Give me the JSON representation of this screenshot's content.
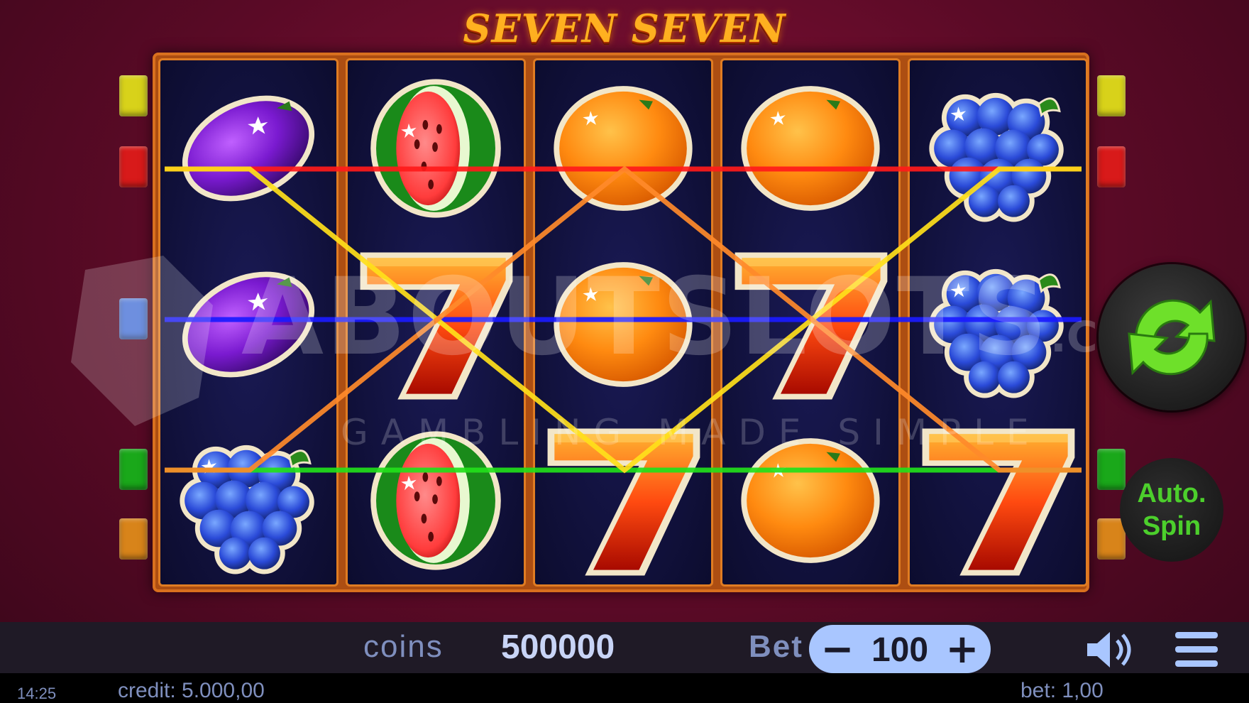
{
  "game": {
    "title": "SEVEN SEVEN"
  },
  "reels": [
    [
      "plum",
      "plum",
      "grapes"
    ],
    [
      "watermelon",
      "seven",
      "watermelon"
    ],
    [
      "orange",
      "orange",
      "seven"
    ],
    [
      "orange",
      "seven",
      "orange"
    ],
    [
      "grapes",
      "grapes",
      "seven"
    ]
  ],
  "paylines": [
    {
      "color": "#ff1a1a",
      "rows": [
        0,
        0,
        0,
        0,
        0
      ]
    },
    {
      "color": "#1a1aff",
      "rows": [
        1,
        1,
        1,
        1,
        1
      ]
    },
    {
      "color": "#22e01a",
      "rows": [
        2,
        2,
        2,
        2,
        2
      ]
    },
    {
      "color": "#ffe01a",
      "rows": [
        0,
        1,
        2,
        1,
        0
      ]
    },
    {
      "color": "#ff8a2a",
      "rows": [
        2,
        1,
        0,
        1,
        2
      ]
    }
  ],
  "line_tab_colors": {
    "yellow": "#d8d21a",
    "red": "#d81a1a",
    "blue": "#4a74d8",
    "green": "#1aa81a",
    "orange": "#d8841a"
  },
  "watermark": {
    "brand": "ABOUTSLOTS",
    "suffix": ".COM",
    "tagline": "GAMBLING MADE SIMPLE"
  },
  "buttons": {
    "spin_icon": "refresh-arrows-icon",
    "auto_spin_line1": "Auto.",
    "auto_spin_line2": "Spin"
  },
  "controls": {
    "coins_label": "coins",
    "coins_value": "500000",
    "bet_label": "Bet",
    "bet_minus": "−",
    "bet_value": "100",
    "bet_plus": "+",
    "sound_icon": "speaker-icon",
    "menu_icon": "hamburger-menu-icon"
  },
  "status": {
    "clock": "14:25",
    "credit": "credit: 5.000,00",
    "bet": "bet: 1,00"
  }
}
